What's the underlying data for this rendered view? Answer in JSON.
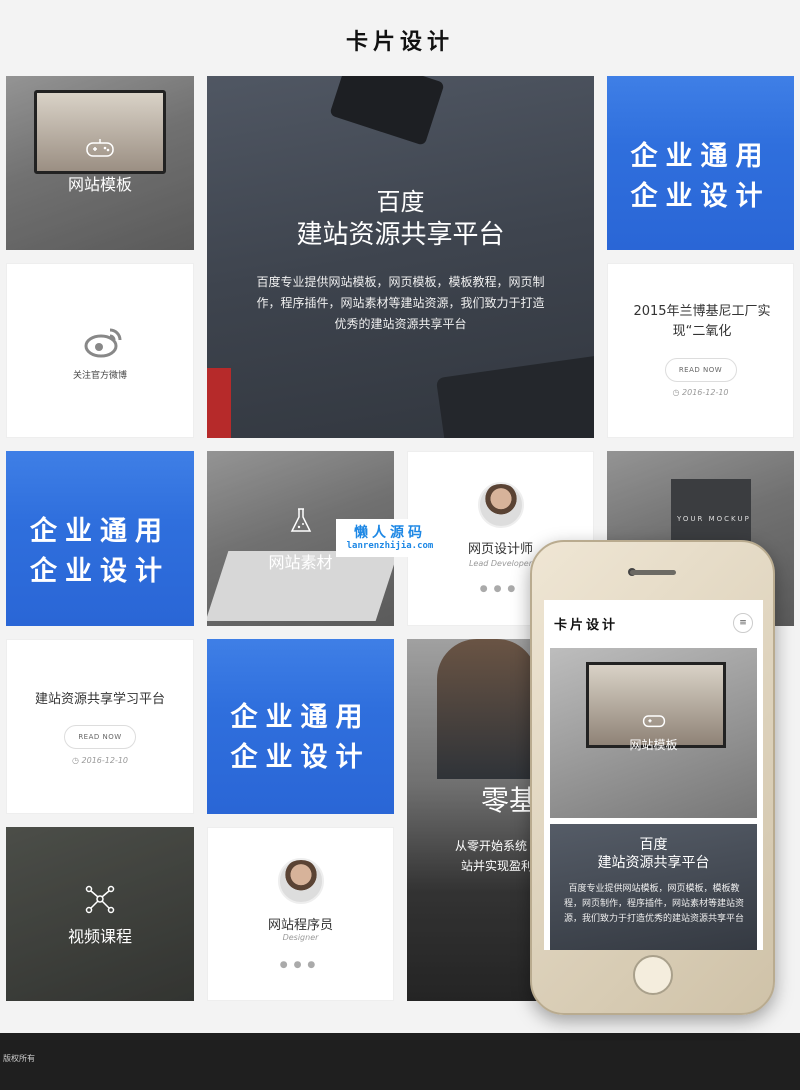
{
  "page": {
    "title": "卡片设计"
  },
  "tiles": {
    "template": {
      "label": "网站模板"
    },
    "hero": {
      "title_line1": "百度",
      "title_line2": "建站资源共享平台",
      "description": "百度专业提供网站模板，网页模板，模板教程，网页制作，程序插件，网站素材等建站资源，我们致力于打造优秀的建站资源共享平台"
    },
    "blue1": {
      "line1": "企业通用",
      "line2": "企业设计"
    },
    "weibo": {
      "label": "关注官方微博"
    },
    "news1": {
      "title": "2015年兰博基尼工厂实现“二氧化",
      "button": "READ NOW",
      "date": "2016-12-10"
    },
    "blue2": {
      "line1": "企业通用",
      "line2": "企业设计"
    },
    "material": {
      "label": "网站素材"
    },
    "designer": {
      "name": "网页设计师",
      "role": "Lead Developer"
    },
    "mockup": {
      "text": "YOUR  MOCKUP"
    },
    "news2": {
      "title": "建站资源共享学习平台",
      "button": "READ NOW",
      "date": "2016-12-10"
    },
    "blue3": {
      "line1": "企业通用",
      "line2": "企业设计"
    },
    "zero": {
      "big": "零基",
      "line1": "从零开始系统",
      "line2": "站并实现盈利"
    },
    "video": {
      "label": "视频课程"
    },
    "programmer": {
      "name": "网站程序员",
      "role": "Designer"
    }
  },
  "watermark": {
    "name": "懒人源码",
    "url": "lanrenzhijia.com"
  },
  "phone": {
    "title": "卡片设计",
    "menu_icon": "≡",
    "card1_label": "网站模板",
    "card2_title_line1": "百度",
    "card2_title_line2": "建站资源共享平台",
    "card2_desc": "百度专业提供网站模板，网页模板，模板教程，网页制作，程序插件，网站素材等建站资源，我们致力于打造优秀的建站资源共享平台"
  },
  "footer": {
    "text": "版权所有"
  },
  "colors": {
    "blue": "#2f6fdd",
    "footer": "#1f1f1f"
  }
}
